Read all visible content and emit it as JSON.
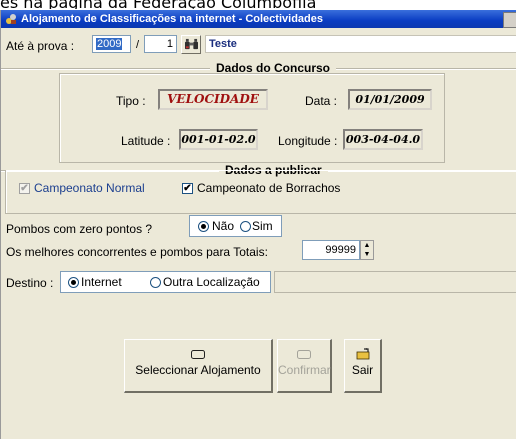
{
  "background_text": "es na página da Federação Columbófila",
  "window": {
    "title": "Alojamento de Classificações na internet - Colectividades"
  },
  "prova": {
    "label": "Até à prova :",
    "year": "2009",
    "separator": "/",
    "number": "1",
    "name": "Teste"
  },
  "concurso": {
    "legend": "Dados do Concurso",
    "tipo_label": "Tipo :",
    "tipo_value": "VELOCIDADE",
    "tipo_color": "#a01010",
    "data_label": "Data :",
    "data_value": "01/01/2009",
    "latitude_label": "Latitude :",
    "latitude_value": "001-01-02.0",
    "longitude_label": "Longitude :",
    "longitude_value": "003-04-04.0"
  },
  "publicar": {
    "legend": "Dados a publicar",
    "normal_label": "Campeonato Normal",
    "normal_color": "#1c3f8f",
    "borrachos_label": "Campeonato de Borrachos"
  },
  "zero_pontos": {
    "label": "Pombos com zero pontos ?",
    "option_nao": "Não",
    "option_sim": "Sim",
    "selected": "Não"
  },
  "totais": {
    "label": "Os melhores concorrentes e pombos para Totais:",
    "value": "99999"
  },
  "destino": {
    "label": "Destino :",
    "option_internet": "Internet",
    "option_outra": "Outra Localização",
    "selected": "Internet",
    "path": ""
  },
  "buttons": {
    "select_label": "Seleccionar Alojamento",
    "confirm_label": "Confirmar",
    "exit_label": "Sair"
  }
}
